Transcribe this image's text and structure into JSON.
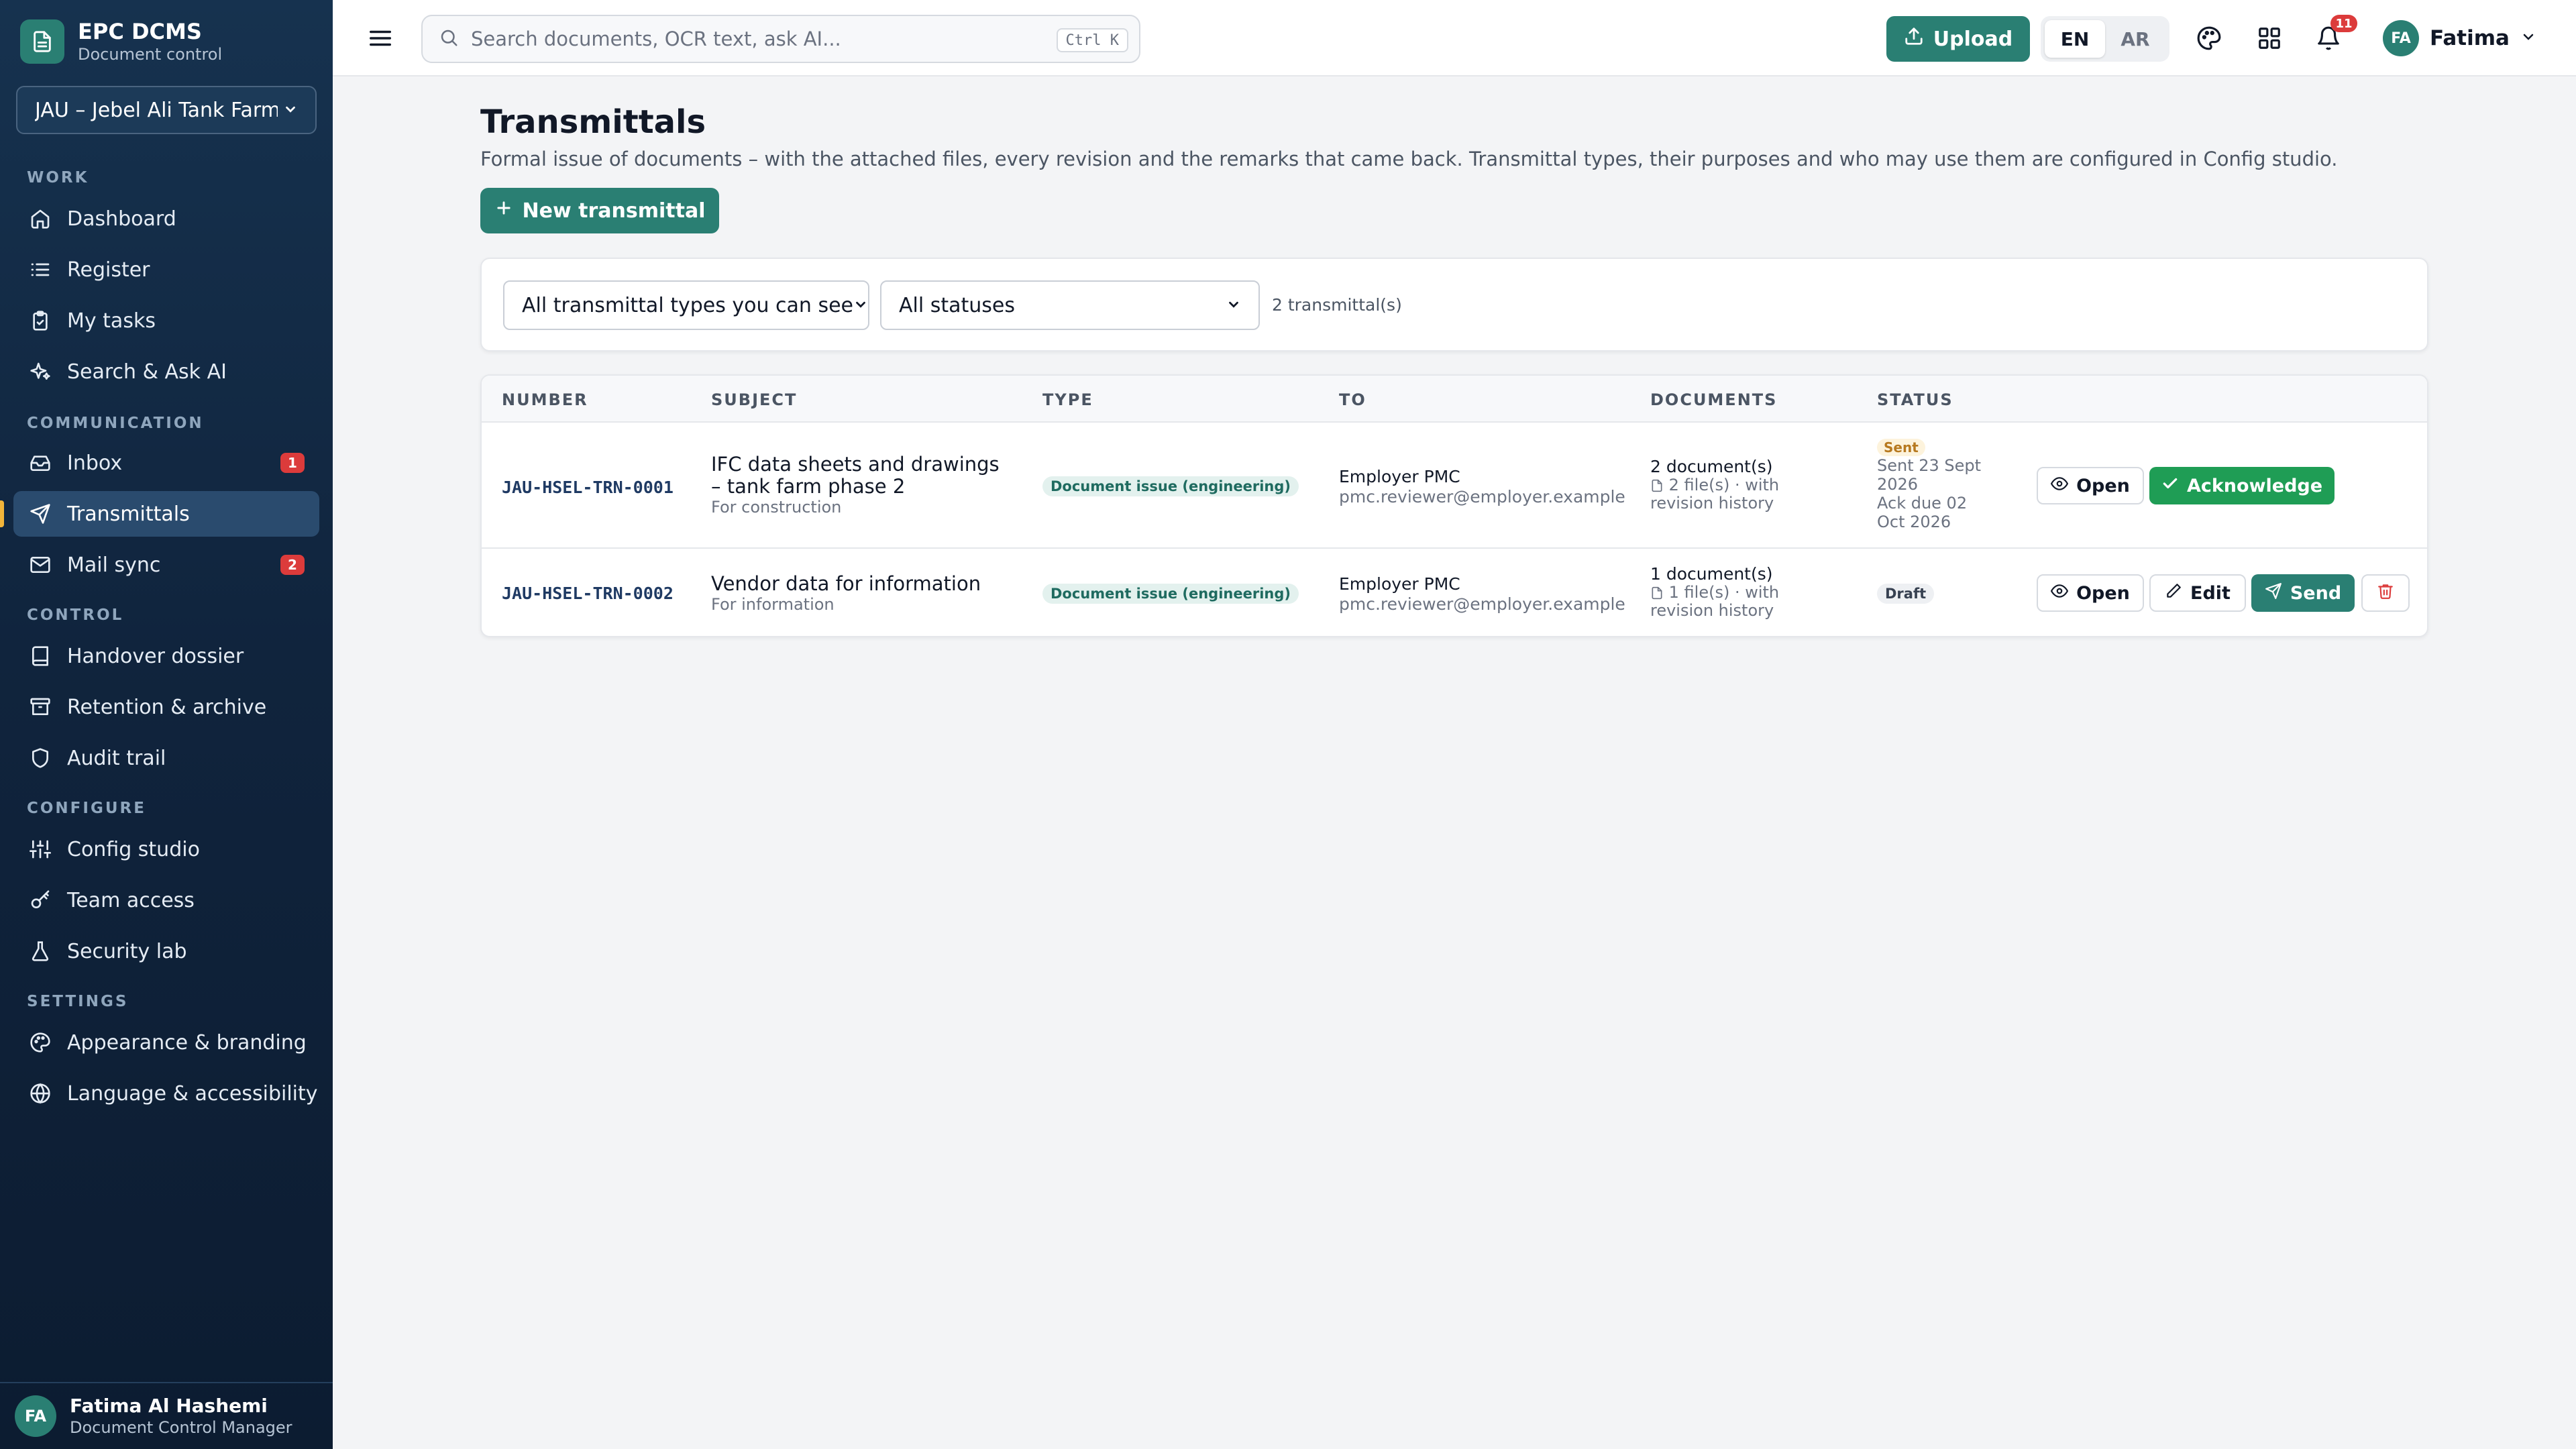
{
  "app": {
    "name": "EPC DCMS",
    "subtitle": "Document control",
    "project": "JAU – Jebel Ali Tank Farm E"
  },
  "sidebar": {
    "sections": {
      "work": "WORK",
      "communication": "COMMUNICATION",
      "control": "CONTROL",
      "configure": "CONFIGURE",
      "settings": "SETTINGS"
    },
    "items": {
      "dashboard": "Dashboard",
      "register": "Register",
      "my_tasks": "My tasks",
      "search_ai": "Search & Ask AI",
      "inbox": "Inbox",
      "inbox_badge": "1",
      "transmittals": "Transmittals",
      "mail_sync": "Mail sync",
      "mail_sync_badge": "2",
      "handover": "Handover dossier",
      "retention": "Retention & archive",
      "audit": "Audit trail",
      "config_studio": "Config studio",
      "team_access": "Team access",
      "security_lab": "Security lab",
      "appearance": "Appearance & branding",
      "language": "Language & accessibility"
    },
    "active": "transmittals",
    "user": {
      "initials": "FA",
      "name": "Fatima Al Hashemi",
      "role": "Document Control Manager"
    }
  },
  "topbar": {
    "search_placeholder": "Search documents, OCR text, ask AI...",
    "search_shortcut": "Ctrl K",
    "upload_label": "Upload",
    "lang_en": "EN",
    "lang_ar": "AR",
    "notifications_count": "11",
    "user_initials": "FA",
    "user_name": "Fatima"
  },
  "page": {
    "title": "Transmittals",
    "description": "Formal issue of documents – with the attached files, every revision and the remarks that came back. Transmittal types, their purposes and who may use them are configured in Config studio.",
    "new_button": "New transmittal"
  },
  "filters": {
    "type_selected": "All transmittal types you can see",
    "status_selected": "All statuses",
    "count_text": "2 transmittal(s)"
  },
  "table": {
    "headers": {
      "number": "NUMBER",
      "subject": "SUBJECT",
      "type": "TYPE",
      "to": "TO",
      "documents": "DOCUMENTS",
      "status": "STATUS"
    },
    "rows": [
      {
        "number": "JAU-HSEL-TRN-0001",
        "subject_line1": "IFC data sheets and drawings",
        "subject_line2": "– tank farm phase 2",
        "purpose": "For construction",
        "type": "Document issue (engineering)",
        "to_name": "Employer PMC",
        "to_email": "pmc.reviewer@employer.example",
        "documents": "2 document(s)",
        "files_line1": "2 file(s) · with",
        "files_line2": "revision history",
        "status": "Sent",
        "status_line1": "Sent 23 Sept",
        "status_line2": "2026",
        "status_line3": "Ack due 02",
        "status_line4": "Oct 2026",
        "actions": {
          "open": "Open",
          "acknowledge": "Acknowledge"
        }
      },
      {
        "number": "JAU-HSEL-TRN-0002",
        "subject_line1": "Vendor data for information",
        "purpose": "For information",
        "type": "Document issue (engineering)",
        "to_name": "Employer PMC",
        "to_email": "pmc.reviewer@employer.example",
        "documents": "1 document(s)",
        "files_line1": "1 file(s) · with",
        "files_line2": "revision history",
        "status": "Draft",
        "actions": {
          "open": "Open",
          "edit": "Edit",
          "send": "Send"
        }
      }
    ]
  },
  "colors": {
    "brand_teal": "#2a7f73",
    "sidebar_bg": "#10243d",
    "acknowledge_green": "#1f9d55",
    "badge_red": "#dc3b3b",
    "active_marker": "#f2b53a"
  },
  "icons": {
    "brand": "document-icon",
    "search": "search-icon",
    "upload": "upload-icon",
    "palette": "palette-icon",
    "apps": "grid-icon",
    "notifications": "bell-icon",
    "delete": "trash-icon"
  }
}
